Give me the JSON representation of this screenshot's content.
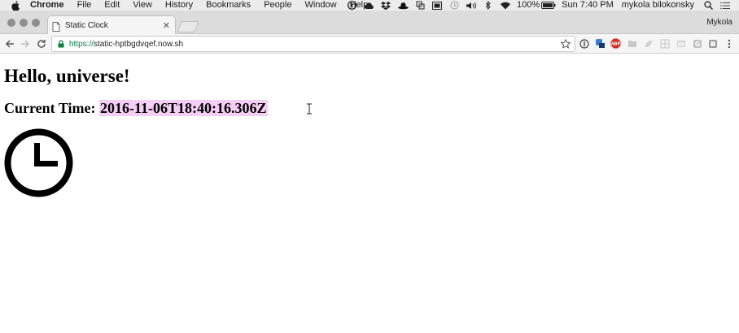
{
  "menubar": {
    "app_name": "Chrome",
    "menus": [
      "File",
      "Edit",
      "View",
      "History",
      "Bookmarks",
      "People",
      "Window",
      "Help"
    ],
    "battery": "100%",
    "clock": "Sun 7:40 PM",
    "user": "mykola bilokonsky"
  },
  "tabs": {
    "active_title": "Static Clock",
    "profile_name": "Mykola"
  },
  "toolbar": {
    "url_scheme": "https://",
    "url_host": "static-hptbgdvqef.now.sh"
  },
  "page": {
    "heading": "Hello, universe!",
    "time_label": "Current Time: ",
    "time_value": "2016-11-06T18:40:16.306Z"
  },
  "colors": {
    "selection_highlight": "#f5cdf5",
    "secure_green": "#0b8043"
  }
}
